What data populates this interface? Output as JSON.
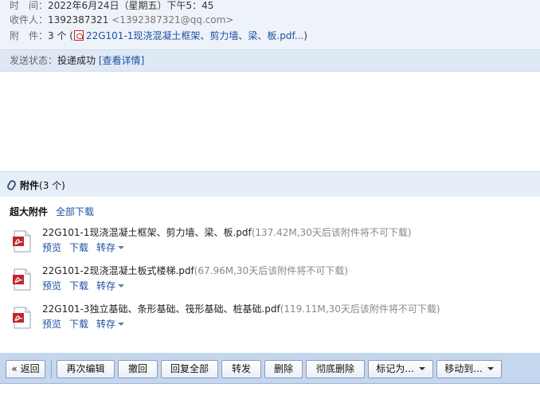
{
  "header": {
    "time_label": "时　间：",
    "time_value": "2022年6月24日（星期五）下午5：45",
    "to_label": "收件人：",
    "to_name": "1392387321",
    "to_email": "<1392387321@qq.com>",
    "att_label": "附　件：",
    "att_count_text": "3 个 (",
    "att_first_link": "22G101-1现浇混凝土框架、剪力墙、梁、板.pdf...",
    "att_close": ")"
  },
  "status": {
    "label": "发送状态：",
    "value": "投递成功",
    "detail": "[查看详情]"
  },
  "attachments": {
    "title": "附件",
    "count": "(3 个)",
    "super_label": "超大附件",
    "download_all": "全部下载",
    "action_preview": "预览",
    "action_download": "下载",
    "action_save": "转存",
    "items": [
      {
        "name": "22G101-1现浇混凝土框架、剪力墙、梁、板.pdf",
        "meta": "(137.42M,30天后该附件将不可下载)",
        "icon": "pdf-file-icon"
      },
      {
        "name": "22G101-2现浇混凝土板式楼梯.pdf",
        "meta": "(67.96M,30天后该附件将不可下载)",
        "icon": "pdf-file-icon"
      },
      {
        "name": "22G101-3独立基础、条形基础、筏形基础、桩基础.pdf",
        "meta": "(119.11M,30天后该附件将不可下载)",
        "icon": "pdf-file-icon"
      }
    ]
  },
  "toolbar": {
    "back": "« 返回",
    "reedit": "再次编辑",
    "recall": "撤回",
    "reply_all": "回复全部",
    "forward": "转发",
    "delete": "删除",
    "delete_permanent": "彻底删除",
    "mark_as": "标记为...",
    "move_to": "移动到..."
  },
  "colors": {
    "link": "#1e50a2",
    "header_bg": "#eef3fa",
    "status_bg": "#dfe8f5",
    "toolbar_bg": "#c5d7ee",
    "pdf_red": "#c0282d"
  }
}
